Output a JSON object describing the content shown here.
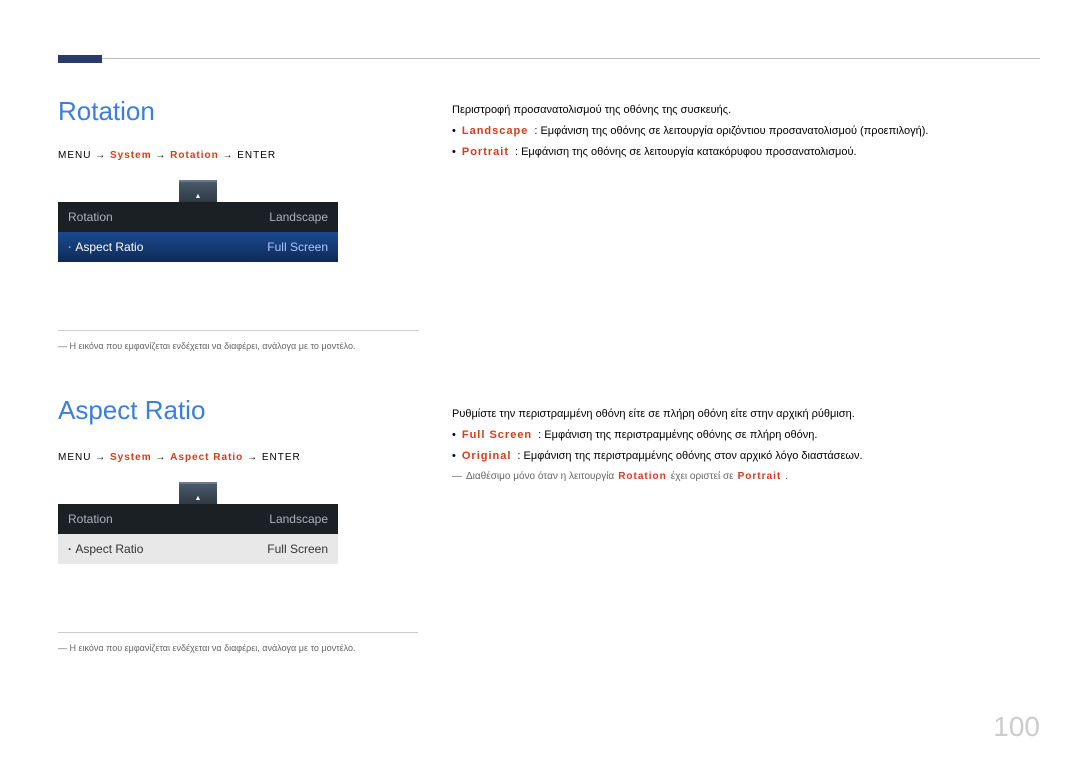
{
  "page_number": "100",
  "section1": {
    "title": "Rotation",
    "breadcrumb_pre": "MENU",
    "breadcrumb_arrow": "→",
    "breadcrumb_mid": "System",
    "breadcrumb_mid2": "Rotation",
    "breadcrumb_end": "ENTER",
    "menu": {
      "row1_label": "Rotation",
      "row1_value": "Landscape",
      "row2_label": "Aspect Ratio",
      "row2_value": "Full Screen"
    },
    "caption": "Η εικόνα που εμφανίζεται ενδέχεται να διαφέρει, ανάλογα με το μοντέλο.",
    "desc_intro": "Περιστροφή προσανατολισμού της οθόνης της συσκευής.",
    "item1_label_lead": "•",
    "item1_label_red": "Landscape",
    "item1_text": ": Εμφάνιση της οθόνης σε λειτουργία οριζόντιου προσανατολισμού (προεπιλογή).",
    "item2_label_lead": "•",
    "item2_label_red": "Portrait",
    "item2_text": ": Εμφάνιση της οθόνης σε λειτουργία κατακόρυφου προσανατολισμού."
  },
  "section2": {
    "title": "Aspect Ratio",
    "breadcrumb_pre": "MENU",
    "breadcrumb_arrow": "→",
    "breadcrumb_mid": "System",
    "breadcrumb_mid2_red": "Aspect Ratio",
    "breadcrumb_end": "ENTER",
    "menu": {
      "row1_label": "Rotation",
      "row1_value": "Landscape",
      "row2_label": "Aspect Ratio",
      "row2_value": "Full Screen"
    },
    "caption": "Η εικόνα που εμφανίζεται ενδέχεται να διαφέρει, ανάλογα με το μοντέλο.",
    "desc_intro": "Ρυθμίστε την περιστραμμένη οθόνη είτε σε πλήρη οθόνη είτε στην αρχική ρύθμιση.",
    "item1_label_lead": "•",
    "item1_label_red": "Full Screen",
    "item1_text": ": Εμφάνιση της περιστραμμένης οθόνης σε πλήρη οθόνη.",
    "item2_label_lead": "•",
    "item2_label_red": "Original",
    "item2_text": ": Εμφάνιση της περιστραμμένης οθόνης στον αρχικό λόγο διαστάσεων.",
    "note_dash": "―",
    "note_pre": "Διαθέσιμο μόνο όταν η λειτουργία",
    "note_red1": "Rotation",
    "note_mid": "έχει οριστεί σε",
    "note_red2": "Portrait",
    "note_dot": "."
  }
}
